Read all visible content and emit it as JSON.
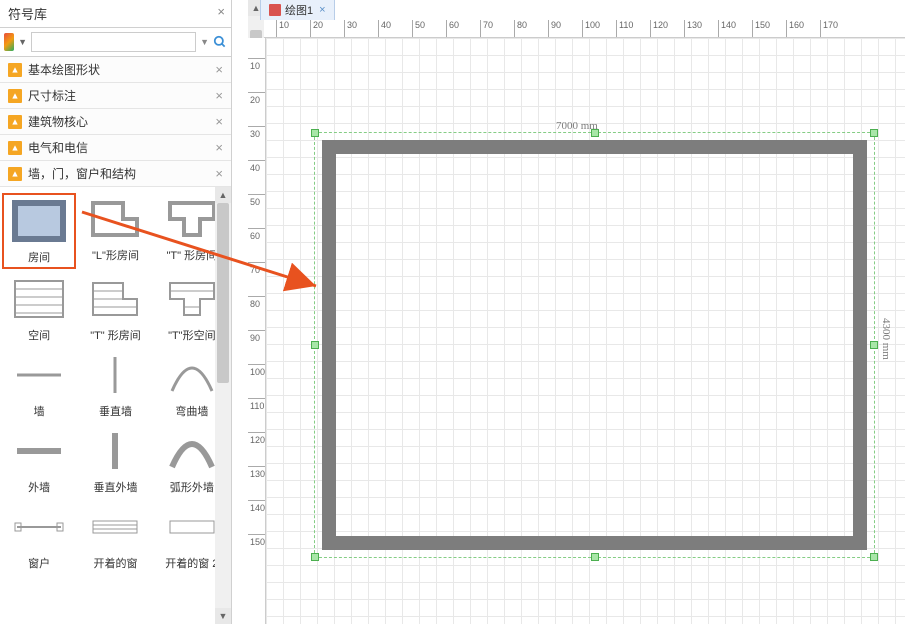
{
  "sidebar": {
    "title": "符号库",
    "search_placeholder": "",
    "categories": [
      {
        "label": "基本绘图形状"
      },
      {
        "label": "尺寸标注"
      },
      {
        "label": "建筑物核心"
      },
      {
        "label": "电气和电信"
      },
      {
        "label": "墙，门，窗户和结构"
      }
    ],
    "shapes": [
      {
        "label": "房间",
        "selected": true
      },
      {
        "label": "\"L\"形房间"
      },
      {
        "label": "\"T\" 形房间"
      },
      {
        "label": "空间"
      },
      {
        "label": "\"T\" 形房间"
      },
      {
        "label": "\"T\"形空间"
      },
      {
        "label": "墙"
      },
      {
        "label": "垂直墙"
      },
      {
        "label": "弯曲墙"
      },
      {
        "label": "外墙"
      },
      {
        "label": "垂直外墙"
      },
      {
        "label": "弧形外墙"
      },
      {
        "label": "窗户"
      },
      {
        "label": "开着的窗"
      },
      {
        "label": "开着的窗 2"
      }
    ]
  },
  "tabs": [
    {
      "label": "绘图1"
    }
  ],
  "ruler_h": [
    "10",
    "20",
    "30",
    "40",
    "50",
    "60",
    "70",
    "80",
    "90",
    "100",
    "110",
    "120",
    "130",
    "140",
    "150",
    "160",
    "170"
  ],
  "ruler_v": [
    "10",
    "20",
    "30",
    "40",
    "50",
    "60",
    "70",
    "80",
    "90",
    "100",
    "110",
    "120",
    "130",
    "140",
    "150"
  ],
  "dimensions": {
    "width": "7000 mm",
    "height": "4300 mm"
  }
}
